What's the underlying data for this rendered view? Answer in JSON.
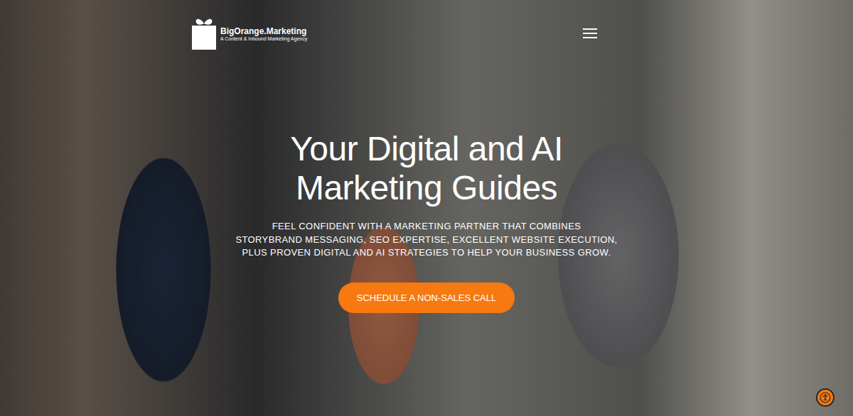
{
  "header": {
    "logo": {
      "name": "BigOrange.Marketing",
      "tagline": "A Content & Inbound Marketing Agency"
    }
  },
  "hero": {
    "headline": [
      "Your Digital and AI",
      "Marketing Guides"
    ],
    "subtitle": [
      "FEEL CONFIDENT WITH A MARKETING PARTNER THAT COMBINES",
      "STORYBRAND MESSAGING, SEO EXPERTISE, EXCELLENT WEBSITE EXECUTION,",
      "PLUS PROVEN DIGITAL AND AI STRATEGIES TO HELP YOUR BUSINESS GROW."
    ],
    "button": "SCHEDULE A NON-SALES CALL"
  }
}
